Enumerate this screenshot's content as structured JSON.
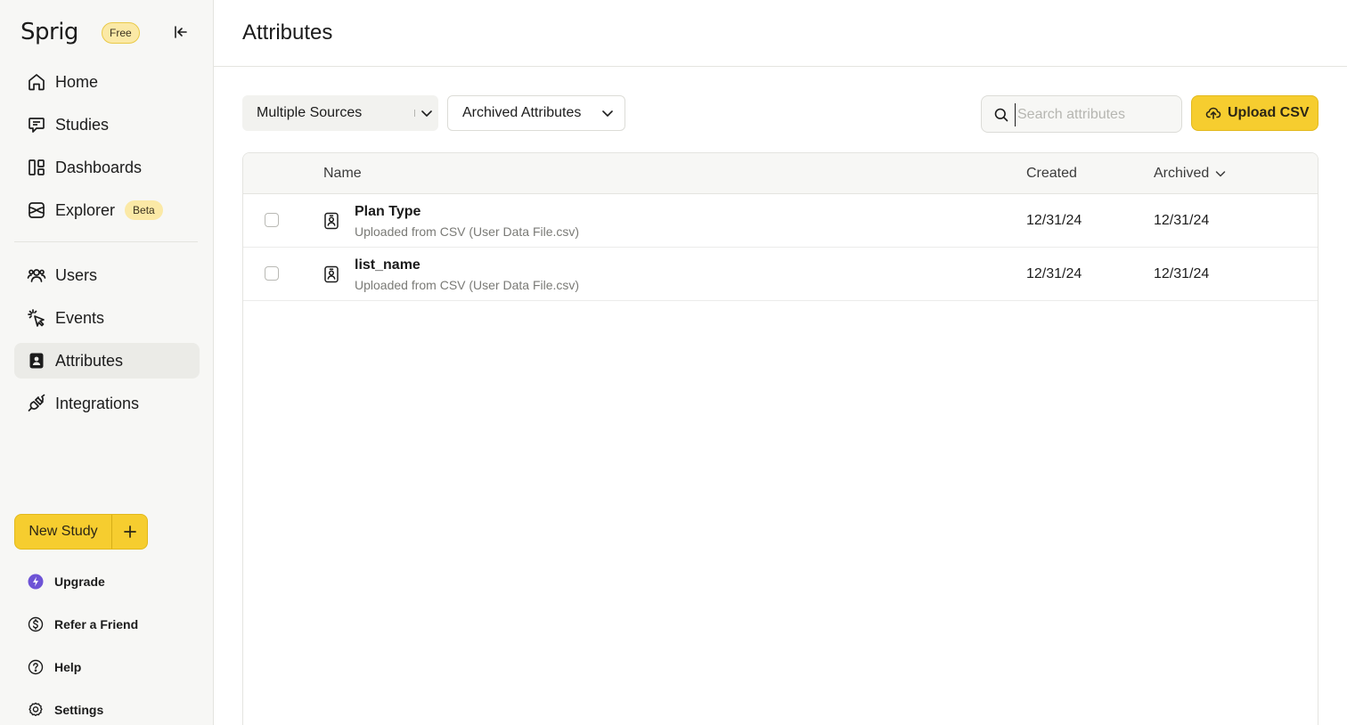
{
  "sidebar": {
    "logo": "Sprig",
    "plan_badge": "Free",
    "nav": [
      {
        "label": "Home",
        "icon": "home-icon"
      },
      {
        "label": "Studies",
        "icon": "studies-icon"
      },
      {
        "label": "Dashboards",
        "icon": "dashboards-icon"
      },
      {
        "label": "Explorer",
        "icon": "explorer-icon",
        "badge": "Beta"
      },
      {
        "label": "Users",
        "icon": "users-icon"
      },
      {
        "label": "Events",
        "icon": "events-icon"
      },
      {
        "label": "Attributes",
        "icon": "attributes-icon",
        "active": true
      },
      {
        "label": "Integrations",
        "icon": "integrations-icon"
      }
    ],
    "new_study_label": "New Study",
    "utility": [
      {
        "label": "Upgrade",
        "icon": "upgrade-icon"
      },
      {
        "label": "Refer a Friend",
        "icon": "dollar-icon"
      },
      {
        "label": "Help",
        "icon": "help-icon"
      },
      {
        "label": "Settings",
        "icon": "settings-icon"
      }
    ]
  },
  "header": {
    "title": "Attributes"
  },
  "filters": {
    "sources": "Multiple Sources",
    "status": "Archived Attributes"
  },
  "search": {
    "placeholder": "Search attributes",
    "value": ""
  },
  "upload_label": "Upload CSV",
  "table": {
    "columns": {
      "name": "Name",
      "created": "Created",
      "archived": "Archived"
    },
    "rows": [
      {
        "name": "Plan Type",
        "source": "Uploaded from CSV (User Data File.csv)",
        "created": "12/31/24",
        "archived": "12/31/24"
      },
      {
        "name": "list_name",
        "source": "Uploaded from CSV (User Data File.csv)",
        "created": "12/31/24",
        "archived": "12/31/24"
      }
    ]
  },
  "colors": {
    "accent": "#f6cd2f",
    "sidebar_bg": "#f7f7f5",
    "upgrade_purple": "#6e54d6"
  }
}
